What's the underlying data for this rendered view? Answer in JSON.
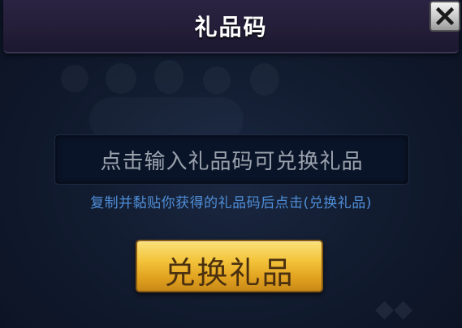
{
  "dialog": {
    "title": "礼品码",
    "close_icon": "close-x-icon"
  },
  "input": {
    "placeholder": "点击输入礼品码可兑换礼品",
    "value": ""
  },
  "hint": "复制并黏贴你获得的礼品码后点击(兑换礼品)",
  "button": {
    "label": "兑换礼品"
  },
  "colors": {
    "title_bar": "#231d38",
    "hint_text": "#4f8ed8",
    "button_gold": "#f3c33a",
    "button_text": "#4a3010",
    "background": "#121c30"
  }
}
